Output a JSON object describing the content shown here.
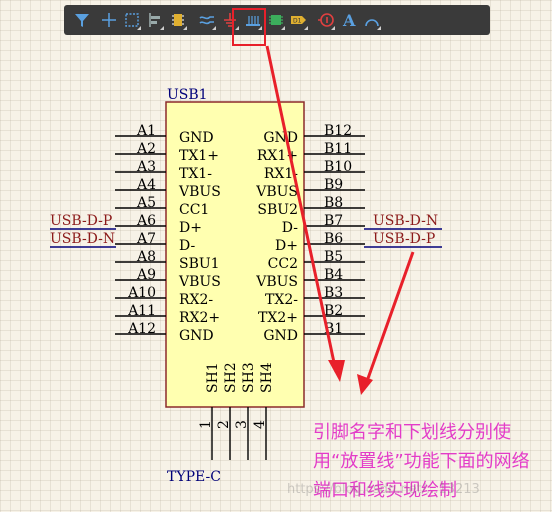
{
  "toolbar": {
    "items": [
      {
        "icon": "filter-icon"
      },
      {
        "icon": "crosshair-icon"
      },
      {
        "icon": "select-rectangle-icon"
      },
      {
        "icon": "align-icon"
      },
      {
        "icon": "component-icon"
      },
      {
        "icon": "place-wire-icon"
      },
      {
        "icon": "ground-icon"
      },
      {
        "icon": "bus-icon"
      },
      {
        "icon": "chip-icon"
      },
      {
        "icon": "port-icon",
        "label": "D1"
      },
      {
        "icon": "no-erc-icon"
      },
      {
        "icon": "text-icon",
        "label": "A"
      },
      {
        "icon": "arc-icon"
      }
    ],
    "highlighted": "place-wire-icon"
  },
  "component": {
    "designator": "USB1",
    "value": "TYPE-C",
    "left_pins": [
      {
        "num": "A1",
        "name": "GND",
        "net": ""
      },
      {
        "num": "A2",
        "name": "TX1+",
        "net": ""
      },
      {
        "num": "A3",
        "name": "TX1-",
        "net": ""
      },
      {
        "num": "A4",
        "name": "VBUS",
        "net": ""
      },
      {
        "num": "A5",
        "name": "CC1",
        "net": ""
      },
      {
        "num": "A6",
        "name": "D+",
        "net": "USB-D-P"
      },
      {
        "num": "A7",
        "name": "D-",
        "net": "USB-D-N"
      },
      {
        "num": "A8",
        "name": "SBU1",
        "net": ""
      },
      {
        "num": "A9",
        "name": "VBUS",
        "net": ""
      },
      {
        "num": "A10",
        "name": "RX2-",
        "net": ""
      },
      {
        "num": "A11",
        "name": "RX2+",
        "net": ""
      },
      {
        "num": "A12",
        "name": "GND",
        "net": ""
      }
    ],
    "right_pins": [
      {
        "num": "B12",
        "name": "GND",
        "net": ""
      },
      {
        "num": "B11",
        "name": "RX1+",
        "net": ""
      },
      {
        "num": "B10",
        "name": "RX1-",
        "net": ""
      },
      {
        "num": "B9",
        "name": "VBUS",
        "net": ""
      },
      {
        "num": "B8",
        "name": "SBU2",
        "net": ""
      },
      {
        "num": "B7",
        "name": "D-",
        "net": "USB-D-N"
      },
      {
        "num": "B6",
        "name": "D+",
        "net": "USB-D-P"
      },
      {
        "num": "B5",
        "name": "CC2",
        "net": ""
      },
      {
        "num": "B4",
        "name": "VBUS",
        "net": ""
      },
      {
        "num": "B3",
        "name": "TX2-",
        "net": ""
      },
      {
        "num": "B2",
        "name": "TX2+",
        "net": ""
      },
      {
        "num": "B1",
        "name": "GND",
        "net": ""
      }
    ],
    "bottom_pins": [
      {
        "num": "1",
        "name": "SH1"
      },
      {
        "num": "2",
        "name": "SH2"
      },
      {
        "num": "3",
        "name": "SH3"
      },
      {
        "num": "4",
        "name": "SH4"
      }
    ]
  },
  "annotation": {
    "text": "引脚名字和下划线分别使用“放置线”功能下面的网络端口和线实现绘制",
    "color": "#e33cc8"
  },
  "watermark": "https://blog.csdn.net/...13213"
}
